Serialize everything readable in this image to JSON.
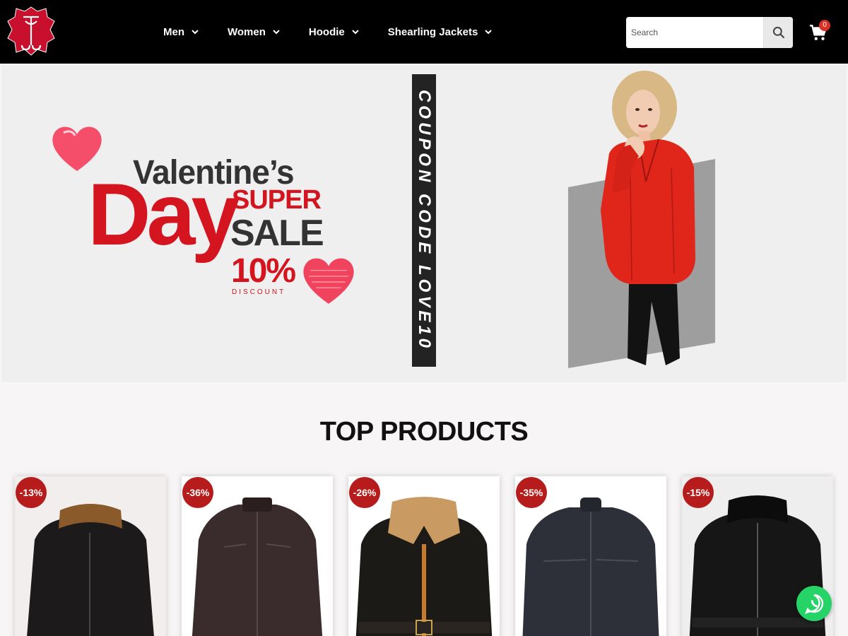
{
  "brand": {
    "logo_icon": "leather-hide-logo-icon"
  },
  "nav": {
    "items": [
      {
        "label": "Men"
      },
      {
        "label": "Women"
      },
      {
        "label": "Hoodie"
      },
      {
        "label": "Shearling Jackets"
      }
    ]
  },
  "search": {
    "placeholder": "Search",
    "value": ""
  },
  "cart": {
    "count": "0"
  },
  "hero": {
    "line1": "Valentine’s",
    "line2": "Day",
    "line3": "SUPER",
    "line4": "SALE",
    "line5": "10%",
    "line6": "DISCOUNT",
    "coupon": "COUPON CODE LOVE10",
    "accent_color": "#d4141f"
  },
  "section": {
    "title": "TOP PRODUCTS"
  },
  "products": [
    {
      "discount": "-13%",
      "image": "black-leather-bomber-shearling-collar"
    },
    {
      "discount": "-36%",
      "image": "brown-leather-biker-jacket"
    },
    {
      "discount": "-26%",
      "image": "shearling-bomber-b3-jacket"
    },
    {
      "discount": "-35%",
      "image": "navy-leather-racer-jacket"
    },
    {
      "discount": "-15%",
      "image": "black-shearling-aviator-jacket"
    }
  ],
  "colors": {
    "header_bg": "#000000",
    "badge": "#b71c1c",
    "whatsapp": "#25d366"
  }
}
